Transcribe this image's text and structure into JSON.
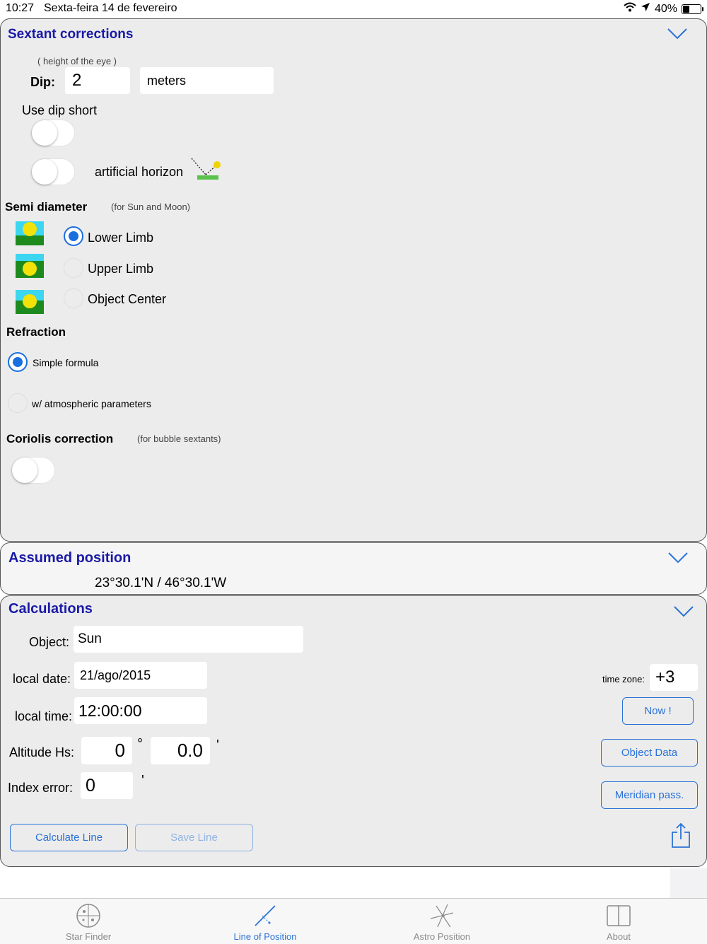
{
  "status_bar": {
    "time": "10:27",
    "date": "Sexta-feira 14 de fevereiro",
    "battery": "40%"
  },
  "sextant": {
    "title": "Sextant corrections",
    "dip": {
      "hint": "( height of the eye )",
      "label": "Dip:",
      "value": "2",
      "unit": "meters"
    },
    "use_dip_short": {
      "label": "Use dip short",
      "on": false
    },
    "artificial_horizon": {
      "label": "artificial horizon",
      "on": false
    },
    "semi_diameter": {
      "title": "Semi diameter",
      "note": "(for Sun and Moon)",
      "options": [
        {
          "label": "Lower Limb",
          "selected": true
        },
        {
          "label": "Upper Limb",
          "selected": false
        },
        {
          "label": "Object Center",
          "selected": false
        }
      ]
    },
    "refraction": {
      "title": "Refraction",
      "options": [
        {
          "label": "Simple formula",
          "selected": true
        },
        {
          "label": "w/ atmospheric parameters",
          "selected": false
        }
      ]
    },
    "coriolis": {
      "title": "Coriolis correction",
      "note": "(for bubble sextants)",
      "on": false
    }
  },
  "assumed": {
    "title": "Assumed position",
    "value": "23°30.1'N / 46°30.1'W"
  },
  "calculations": {
    "title": "Calculations",
    "object": {
      "label": "Object:",
      "value": "Sun"
    },
    "local_date": {
      "label": "local date:",
      "value": "21/ago/2015"
    },
    "local_time": {
      "label": "local time:",
      "value": "12:00:00"
    },
    "time_zone": {
      "label": "time zone:",
      "value": "+3"
    },
    "altitude": {
      "label": "Altitude Hs:",
      "degrees": "0",
      "degree_symbol": "°",
      "minutes": "0.0",
      "minute_symbol": "'"
    },
    "index_error": {
      "label": "Index error:",
      "value": "0",
      "minute_symbol": "'"
    },
    "buttons": {
      "now": "Now !",
      "object_data": "Object Data",
      "meridian": "Meridian pass.",
      "calculate": "Calculate Line",
      "save": "Save Line"
    }
  },
  "tabs": [
    {
      "label": "Star Finder",
      "icon": "star-finder-icon",
      "active": false
    },
    {
      "label": "Line of Position",
      "icon": "line-of-position-icon",
      "active": true
    },
    {
      "label": "Astro Position",
      "icon": "astro-position-icon",
      "active": false
    },
    {
      "label": "About",
      "icon": "book-icon",
      "active": false
    }
  ],
  "colors": {
    "accent": "#2a72d8",
    "title": "#1a1aa8",
    "panel": "#ececec"
  }
}
